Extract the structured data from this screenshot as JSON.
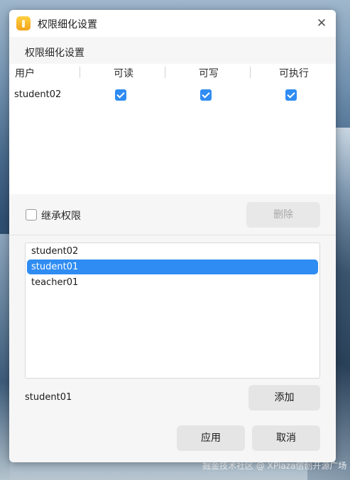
{
  "dialog": {
    "title": "权限细化设置",
    "app_icon": "lock-icon",
    "close_icon": "close-icon",
    "close_glyph": "✕"
  },
  "section_title": "权限细化设置",
  "permissions": {
    "headers": {
      "user": "用户",
      "read": "可读",
      "write": "可写",
      "execute": "可执行"
    },
    "rows": [
      {
        "user": "student02",
        "read": true,
        "write": true,
        "execute": true
      }
    ]
  },
  "inherit": {
    "label": "继承权限",
    "checked": false
  },
  "buttons": {
    "delete": "删除",
    "add": "添加",
    "apply": "应用",
    "cancel": "取消"
  },
  "user_list": {
    "items": [
      "student02",
      "student01",
      "teacher01"
    ],
    "selected_index": 1
  },
  "selected_user": "student01",
  "watermark": "掘金技术社区 @ XPlaza信创开源广场",
  "colors": {
    "accent": "#2f8cf2",
    "dialog_bg": "#f6f6f6"
  }
}
